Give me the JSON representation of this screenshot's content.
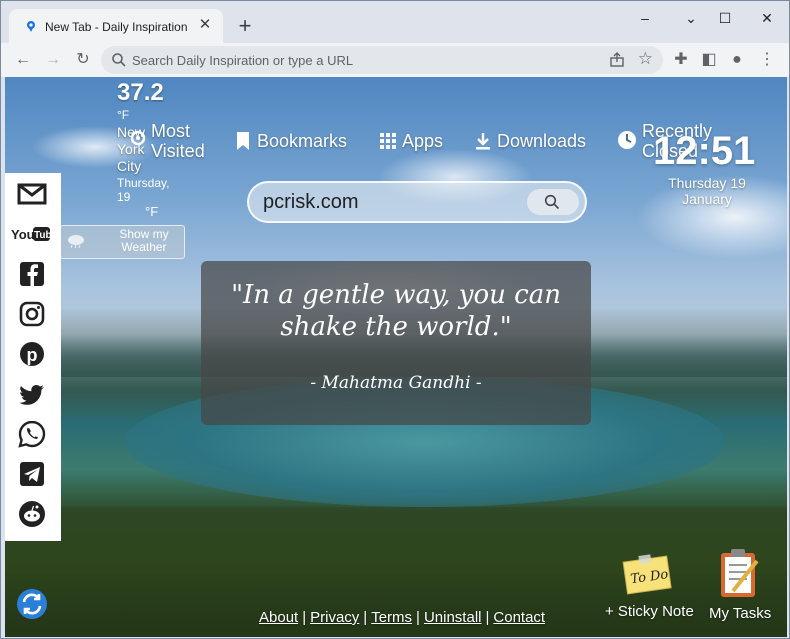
{
  "browser": {
    "tab_title": "New Tab - Daily Inspiration",
    "tab_close": "✕",
    "new_tab": "+",
    "window_controls": {
      "minimize": "–",
      "maximize": "☐",
      "close": "✕"
    },
    "address_placeholder": "Search Daily Inspiration or type a URL"
  },
  "weather": {
    "temperature": "37.2",
    "unit": "°F",
    "city": "New York City",
    "date": "Thursday, 19",
    "unit_secondary": "°F",
    "show_button": "Show my Weather"
  },
  "nav": {
    "most_visited": "Most Visited",
    "bookmarks": "Bookmarks",
    "apps": "Apps",
    "downloads": "Downloads",
    "recently_closed": "Recently Closed"
  },
  "clock": {
    "time": "12:51",
    "date": "Thursday 19 January"
  },
  "search": {
    "value": "pcrisk.com"
  },
  "quote": {
    "text": "\"In a gentle way, you can shake the world.\"",
    "author": "- Mahatma Gandhi -"
  },
  "social": [
    "gmail-icon",
    "youtube-icon",
    "facebook-icon",
    "instagram-icon",
    "pinterest-icon",
    "twitter-icon",
    "whatsapp-icon",
    "telegram-icon",
    "reddit-icon"
  ],
  "footer": {
    "about": "About",
    "privacy": "Privacy",
    "terms": "Terms",
    "uninstall": "Uninstall",
    "contact": "Contact",
    "separator": "|"
  },
  "widgets": {
    "todo_text": "To Do",
    "sticky_note": "+ Sticky Note",
    "my_tasks": "My Tasks"
  },
  "colors": {
    "tab_bar": "#dee3ec",
    "toolbar": "#f1f3f4",
    "quote_card": "#464646",
    "accent_blue": "#1a73e8"
  }
}
